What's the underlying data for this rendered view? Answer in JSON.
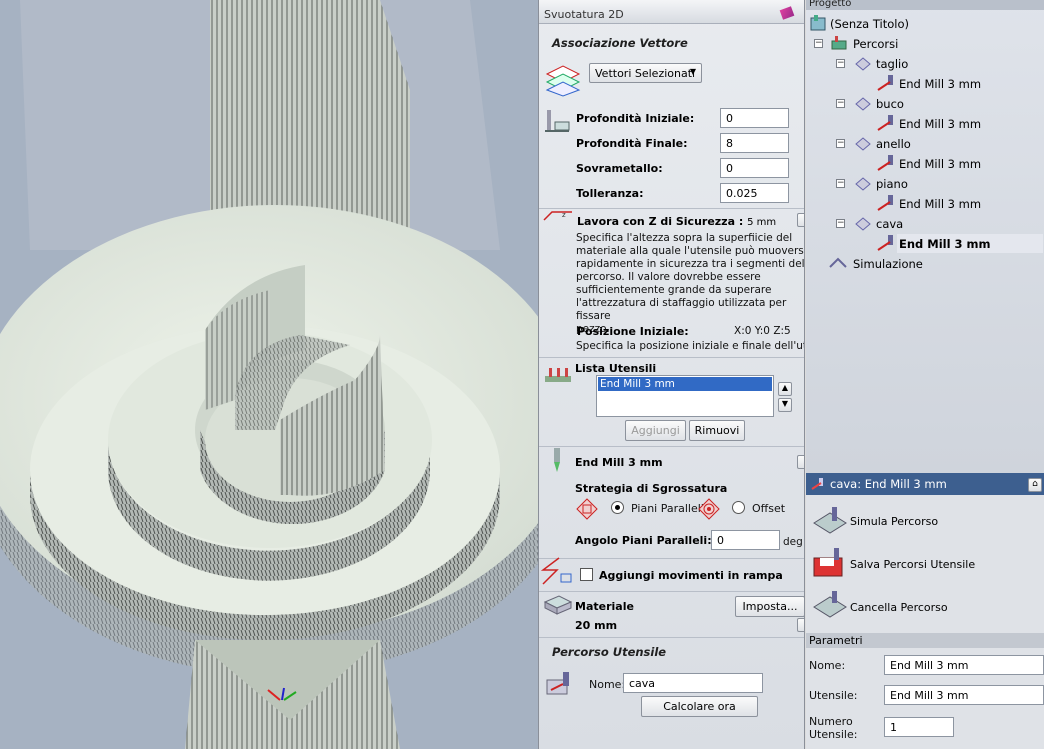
{
  "panel": {
    "title": "Svuotatura 2D",
    "assoc_header": "Associazione Vettore",
    "vector_dropdown": "Vettori Selezionati",
    "fields": [
      {
        "label": "Profondità Iniziale:",
        "value": "0"
      },
      {
        "label": "Profondità Finale:",
        "value": "8"
      },
      {
        "label": "Sovrametallo:",
        "value": "0"
      },
      {
        "label": "Tolleranza:",
        "value": "0.025"
      }
    ],
    "safe_z": {
      "label": "Lavora con Z di Sicurezza :",
      "value": "5 mm",
      "description": [
        "Specifica l'altezza sopra la superfiicie del",
        "materiale alla quale l'utensile può muoversi",
        "rapidamente in sicurezza tra i segmenti del",
        "percorso. Il valore dovrebbe essere",
        "sufficientemente grande da superare",
        "l'attrezzatura di staffaggio utilizzata per fissare",
        "pezzo."
      ],
      "home_label": "Posizione Iniziale:",
      "home_value": "X:0 Y:0 Z:5",
      "home_desc": "Specifica la posizione iniziale e finale dell'utensile"
    },
    "tools": {
      "label": "Lista Utensili",
      "items": [
        "End Mill 3 mm"
      ],
      "add_button": "Aggiungi",
      "remove_button": "Rimuovi"
    },
    "selected_tool": "End Mill 3 mm",
    "strategy": {
      "label": "Strategia di Sgrossatura",
      "option1": "Piani Paralleli",
      "option2": "Offset",
      "angle_label": "Angolo Piani Paralleli:",
      "angle_value": "0",
      "angle_unit": "deg"
    },
    "ramp_label": "Aggiungi movimenti in rampa",
    "material": {
      "label": "Materiale",
      "value": "20 mm",
      "button": "Imposta..."
    },
    "toolpath": {
      "header": "Percorso Utensile",
      "name_label": "Nome:",
      "name_value": "cava",
      "calc_button": "Calcolare ora"
    }
  },
  "project": {
    "header": "Progetto",
    "root": "(Senza Titolo)",
    "group": "Percorsi",
    "paths": [
      {
        "name": "taglio",
        "tool": "End Mill 3 mm"
      },
      {
        "name": "buco",
        "tool": "End Mill 3 mm"
      },
      {
        "name": "anello",
        "tool": "End Mill 3 mm"
      },
      {
        "name": "piano",
        "tool": "End Mill 3 mm"
      },
      {
        "name": "cava",
        "tool": "End Mill 3 mm"
      }
    ],
    "simulation": "Simulazione"
  },
  "sub": {
    "title": "cava: End Mill 3 mm",
    "actions": [
      "Simula Percorso",
      "Salva Percorsi Utensile",
      "Cancella Percorso"
    ],
    "params_header": "Parametri",
    "name_label": "Nome:",
    "name_value": "End Mill 3 mm",
    "tool_label": "Utensile:",
    "tool_value": "End Mill 3 mm",
    "count_label": "Numero Utensile:",
    "count_value": "1"
  },
  "colors": {
    "accent": "#3d5f8f",
    "selection": "#316ac5",
    "material": "#e4ebe0"
  }
}
